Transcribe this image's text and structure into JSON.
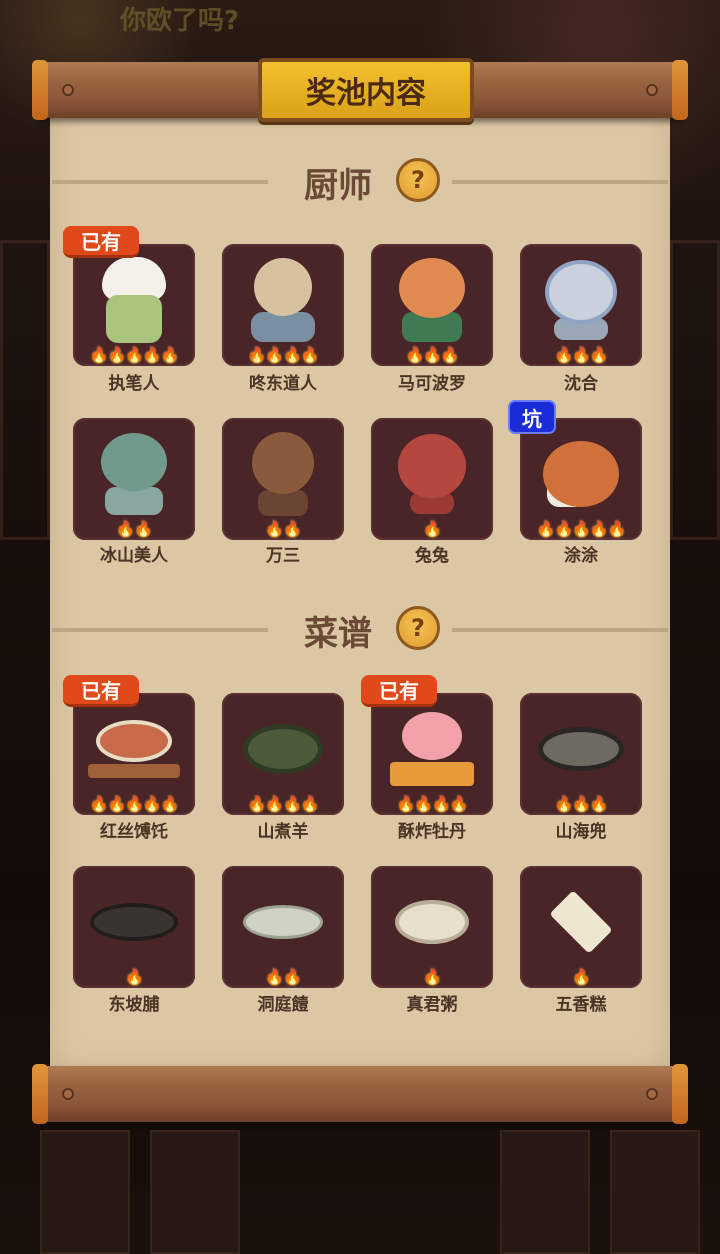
{
  "background": {
    "top_text": "你欧了吗?"
  },
  "dialog": {
    "title": "奖池内容"
  },
  "chef_section": {
    "title": "厨师",
    "help_icon": "?",
    "items": [
      {
        "name": "执笔人",
        "stars": 5,
        "owned": true,
        "badge": "已有"
      },
      {
        "name": "咚东道人",
        "stars": 4,
        "owned": false
      },
      {
        "name": "马可波罗",
        "stars": 3,
        "owned": false
      },
      {
        "name": "沈合",
        "stars": 3,
        "owned": false
      },
      {
        "name": "冰山美人",
        "stars": 2,
        "owned": false
      },
      {
        "name": "万三",
        "stars": 2,
        "owned": false
      },
      {
        "name": "兔兔",
        "stars": 1,
        "owned": false
      },
      {
        "name": "涂涂",
        "stars": 5,
        "owned": false,
        "tag": "坑"
      }
    ]
  },
  "recipe_section": {
    "title": "菜谱",
    "help_icon": "?",
    "items": [
      {
        "name": "红丝馎饦",
        "stars": 5,
        "owned": true,
        "badge": "已有"
      },
      {
        "name": "山煮羊",
        "stars": 4,
        "owned": false
      },
      {
        "name": "酥炸牡丹",
        "stars": 4,
        "owned": true,
        "badge": "已有"
      },
      {
        "name": "山海兜",
        "stars": 3,
        "owned": false
      },
      {
        "name": "东坡脯",
        "stars": 1,
        "owned": false
      },
      {
        "name": "洞庭饐",
        "stars": 2,
        "owned": false
      },
      {
        "name": "真君粥",
        "stars": 1,
        "owned": false
      },
      {
        "name": "五香糕",
        "stars": 1,
        "owned": false
      }
    ]
  },
  "colors": {
    "panel": "#dcc7a5",
    "card": "#4a2527",
    "owned_badge": "#e04a1a",
    "pit_badge": "#1a2bd8",
    "title_plate": "#f2c02e"
  }
}
